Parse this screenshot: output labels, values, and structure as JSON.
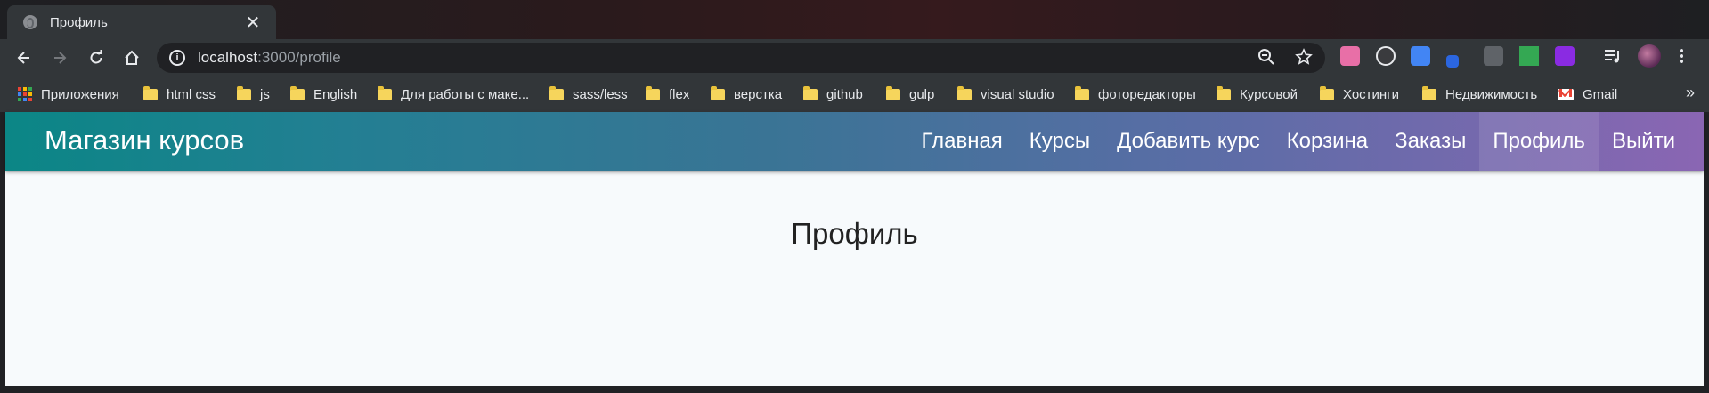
{
  "tab": {
    "title": "Профиль",
    "close": "✕"
  },
  "address_bar": {
    "host": "localhost",
    "path": ":3000/profile"
  },
  "extension_colors": [
    "#e86fa7",
    "#3a3b3e",
    "#4285f4",
    "#2b66e0",
    "#5f6368",
    "#34a853",
    "#8a2be2"
  ],
  "bookmarks": {
    "apps": "Приложения",
    "folders": [
      "html css",
      "js",
      "English",
      "Для работы с маке...",
      "sass/less",
      "flex",
      "верстка",
      "github",
      "gulp",
      "visual studio",
      "фоторедакторы",
      "Курсовой",
      "Хостинги",
      "Недвижимость"
    ],
    "gmail": "Gmail",
    "more": "»"
  },
  "site": {
    "brand": "Магазин курсов",
    "nav": [
      "Главная",
      "Курсы",
      "Добавить курс",
      "Корзина",
      "Заказы",
      "Профиль",
      "Выйти"
    ],
    "active_nav": "Профиль",
    "page_title": "Профиль",
    "nav_gradient": [
      "#0b8686",
      "#8a66b3"
    ]
  }
}
